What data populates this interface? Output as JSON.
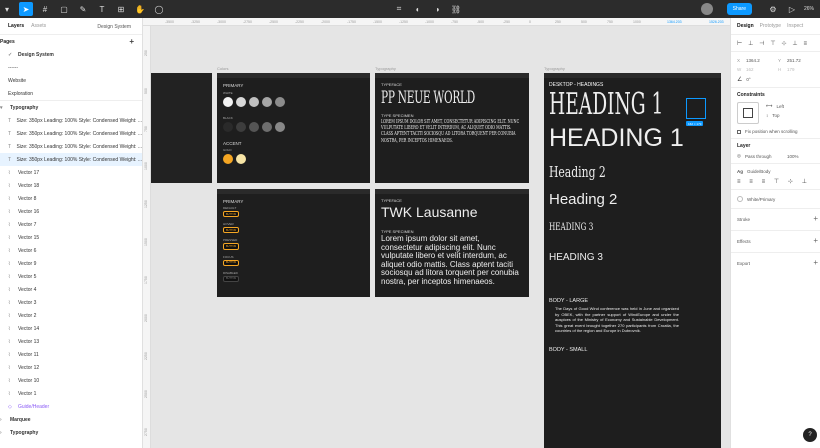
{
  "toolbar": {
    "share_label": "Share",
    "zoom": "26%",
    "accent": "#0d99ff"
  },
  "left_panel": {
    "tabs": [
      "Layers",
      "Assets"
    ],
    "file_name": "Design System",
    "pages_title": "Pages",
    "pages": [
      {
        "label": "Design System",
        "current": true
      },
      {
        "label": "------"
      },
      {
        "label": "Website"
      },
      {
        "label": "Exploration"
      }
    ],
    "layers_root": "Typography",
    "text_layers": [
      "Size: 350px Leading: 100% Style: Condensed Weight: ...",
      "Size: 350px Leading: 100% Style: Condensed Weight: ...",
      "Size: 350px Leading: 100% Style: Condensed Weight: ...",
      "Size: 350px Leading: 100% Style: Condensed Weight: ..."
    ],
    "vectors": [
      "Vector 17",
      "Vector 18",
      "Vector 8",
      "Vector 16",
      "Vector 7",
      "Vector 15",
      "Vector 6",
      "Vector 9",
      "Vector 5",
      "Vector 4",
      "Vector 3",
      "Vector 2",
      "Vector 14",
      "Vector 13",
      "Vector 11",
      "Vector 12",
      "Vector 10",
      "Vector 1"
    ],
    "guide_layer": "Guide/Header",
    "bottom_items": [
      "Marquee",
      "Typography"
    ]
  },
  "rulers": {
    "top_ticks": [
      "-3500",
      "-3250",
      "-3000",
      "-2750",
      "-2500",
      "-2250",
      "-2000",
      "-1750",
      "-1500",
      "-1250",
      "-1000",
      "-750",
      "-500",
      "-250",
      "0",
      "250",
      "500",
      "750",
      "1000",
      "1364.203",
      "1526.203"
    ],
    "left_ticks": [
      "250",
      "500",
      "750",
      "1000",
      "1250",
      "1500",
      "1750",
      "2000",
      "2250",
      "2500",
      "2750"
    ]
  },
  "canvas": {
    "frame_labels": [
      "Colors",
      "Typography",
      "Typography"
    ],
    "colors_frame": {
      "primary": "PRIMARY",
      "white": "WHITE",
      "black": "BLACK",
      "accent": "ACCENT",
      "gold": "GOLD",
      "whites": [
        "#f2f2f2",
        "#d8d8d8",
        "#bfbfbf",
        "#a5a5a5",
        "#8c8c8c"
      ],
      "blacks": [
        "#2a2a2a",
        "#3d3d3d",
        "#555",
        "#6e6e6e",
        "#888"
      ],
      "golds": [
        "#f5a623",
        "#f7e5a6"
      ]
    },
    "buttons_frame": {
      "primary": "PRIMARY",
      "states": [
        "DEFAULT",
        "HOVER",
        "PRESSED",
        "FOCUS",
        "DISABLED"
      ],
      "pill": "BUTTON"
    },
    "type_frame_1": {
      "typeface_label": "TYPEFACE",
      "typeface": "PP NEUE WORLD",
      "specimen_label": "TYPE SPECIMEN",
      "specimen": "LOREM IPSUM DOLOR SIT AMET, CONSECTETUR ADIPISCING ELIT. NUNC VULPUTATE LIBERO ET VELIT INTERDUM, AC ALIQUET ODIO MATTIS. CLASS APTENT TACITI SOCIOSQU AD LITORA TORQUENT PER CONUBIA NOSTRA, PER INCEPTOS HIMENAEOS."
    },
    "type_frame_2": {
      "typeface_label": "TYPEFACE",
      "typeface": "TWK Lausanne",
      "specimen_label": "TYPE SPECIMEN",
      "specimen": "Lorem ipsum dolor sit amet, consectetur adipiscing elit. Nunc vulputate libero et velit interdum, ac aliquet odio mattis. Class aptent taciti sociosqu ad litora torquent per conubia nostra, per inceptos himenaeos."
    },
    "headings_frame": {
      "title": "DESKTOP - HEADINGS",
      "h1a": "HEADING 1",
      "h1b": "HEADING 1",
      "h2a": "Heading 2",
      "h2b": "Heading 2",
      "h3a": "HEADING 3",
      "h3b": "HEADING 3",
      "body_large_label": "BODY - LARGE",
      "body_large": "The Days of Good Wind conference was held in June and organized by OBEK, with the partner support of WindEurope and under the auspices of the Ministry of Economy and Sustainable Development. This great event brought together 270 participants from Croatia, the countries of the region and Europe in Dubrovnik.",
      "body_small_label": "BODY - SMALL",
      "selection_size": "162 × 179"
    }
  },
  "right_panel": {
    "tabs": [
      "Design",
      "Prototype",
      "Inspect"
    ],
    "x": "1364.2",
    "y": "251.72",
    "w": "162",
    "h": "179",
    "rotation": "0°",
    "constraints_title": "Constraints",
    "constraint_h": "Left",
    "constraint_v": "Top",
    "fix_position": "Fix position when scrolling",
    "layer_title": "Layer",
    "blend": "Pass through",
    "opacity": "100%",
    "text_style": "Guide/Body",
    "fill_style": "White/Primary",
    "stroke": "Stroke",
    "effects": "Effects",
    "export": "Export"
  }
}
